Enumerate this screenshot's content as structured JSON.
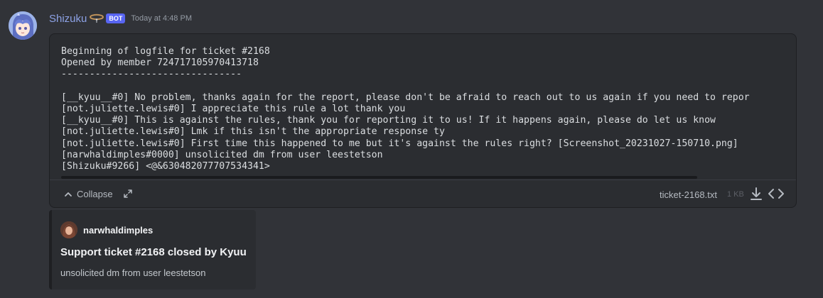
{
  "message": {
    "author": "Shizuku",
    "author_emoji": "leash-emoji",
    "bot_tag": "BOT",
    "timestamp": "Today at 4:48 PM",
    "colors": {
      "username": "#8da2e6",
      "bot_tag_bg": "#5865f2",
      "background": "#313338",
      "card": "#2b2d31"
    }
  },
  "attachment": {
    "log_lines": [
      "Beginning of logfile for ticket #2168",
      "Opened by member 724717105970413718",
      "--------------------------------",
      "",
      "[__kyuu__#0] No problem, thanks again for the report, please don't be afraid to reach out to us again if you need to repor",
      "[not.juliette.lewis#0] I appreciate this rule a lot thank you",
      "[__kyuu__#0] This is against the rules, thank you for reporting it to us! If it happens again, please do let us know",
      "[not.juliette.lewis#0] Lmk if this isn't the appropriate response ty",
      "[not.juliette.lewis#0] First time this happened to me but it's against the rules right? [Screenshot_20231027-150710.png]",
      "[narwhaldimples#0000] unsolicited dm from user leestetson",
      "[Shizuku#9266] <@&630482077707534341>"
    ],
    "collapse_label": "Collapse",
    "expand_icon": "expand-arrows-icon",
    "filename": "ticket-2168.txt",
    "filesize": "1 KB",
    "download_icon": "download-icon",
    "view_code_icon": "code-icon"
  },
  "embed": {
    "author_name": "narwhaldimples",
    "title": "Support ticket #2168 closed by Kyuu",
    "description": "unsolicited dm from user leestetson",
    "color": "#1e1f22"
  }
}
